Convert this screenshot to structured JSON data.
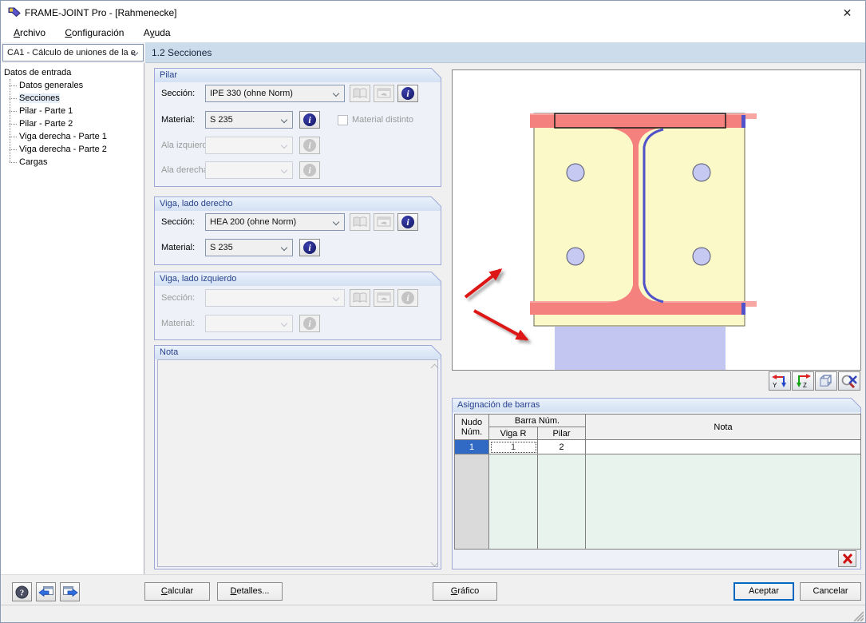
{
  "window": {
    "title": "FRAME-JOINT Pro - [Rahmenecke]",
    "close_glyph": "✕"
  },
  "menu": {
    "archivo": {
      "pre": "",
      "mn": "A",
      "rest": "rchivo"
    },
    "configuracion": {
      "pre": "",
      "mn": "C",
      "rest": "onfiguración"
    },
    "ayuda": {
      "pre": "A",
      "mn": "y",
      "rest": "uda"
    }
  },
  "nav": {
    "case_selector_value": "CA1 - Cálculo de uniones de la e",
    "section_title": "1.2 Secciones"
  },
  "tree": {
    "root": "Datos de entrada",
    "items": [
      {
        "label": "Datos generales"
      },
      {
        "label": "Secciones",
        "selected": true
      },
      {
        "label": "Pilar - Parte 1"
      },
      {
        "label": "Pilar - Parte 2"
      },
      {
        "label": "Viga derecha - Parte 1"
      },
      {
        "label": "Viga derecha - Parte 2"
      },
      {
        "label": "Cargas"
      }
    ]
  },
  "pilar": {
    "title": "Pilar",
    "seccion_label": "Sección:",
    "seccion_value": "IPE 330 (ohne Norm)",
    "material_label": "Material:",
    "material_value": "S 235",
    "material_distinto_label": "Material distinto",
    "ala_izquierda_label": "Ala izquierda:",
    "ala_derecha_label": "Ala derecha:"
  },
  "viga_derecha": {
    "title": "Viga, lado derecho",
    "seccion_label": "Sección:",
    "seccion_value": "HEA 200 (ohne Norm)",
    "material_label": "Material:",
    "material_value": "S 235"
  },
  "viga_izquierda": {
    "title": "Viga, lado izquierdo",
    "seccion_label": "Sección:",
    "seccion_value": "",
    "material_label": "Material:",
    "material_value": ""
  },
  "nota": {
    "title": "Nota",
    "value": ""
  },
  "graphic": {
    "axis_y_label": "Y",
    "axis_z_label": "Z"
  },
  "assignment": {
    "title": "Asignación de barras",
    "header": {
      "nudo_line1": "Nudo",
      "nudo_line2": "Núm.",
      "barra": "Barra Núm.",
      "viga_r": "Viga R",
      "pilar": "Pilar",
      "nota": "Nota"
    },
    "rows": [
      {
        "nudo": "1",
        "viga_r": "1",
        "pilar": "2",
        "nota": ""
      }
    ]
  },
  "footer": {
    "calcular": {
      "pre": "",
      "mn": "C",
      "rest": "alcular"
    },
    "detalles": {
      "pre": "",
      "mn": "D",
      "rest": "etalles..."
    },
    "grafico": {
      "pre": "",
      "mn": "G",
      "rest": "ráfico"
    },
    "aceptar": "Aceptar",
    "cancelar": "Cancelar"
  },
  "colors": {
    "selection_blue": "#316ac5",
    "default_border": "#0067c0",
    "group_header_text": "#27408b",
    "group_border": "#9fa8d5",
    "group_bg": "#eef2f8",
    "header_bar_bg": "#cddceb",
    "steel_red": "#f4817d",
    "steel_red_light": "#f8a6a2",
    "plate_yellow": "#fcf9c8",
    "bolt_fill": "#c6c9f2",
    "column_fill": "#c3c6f0",
    "outline_blue": "#5151c9",
    "arrow_red": "#dd1412",
    "table_empty_green": "#e9f3ee"
  }
}
